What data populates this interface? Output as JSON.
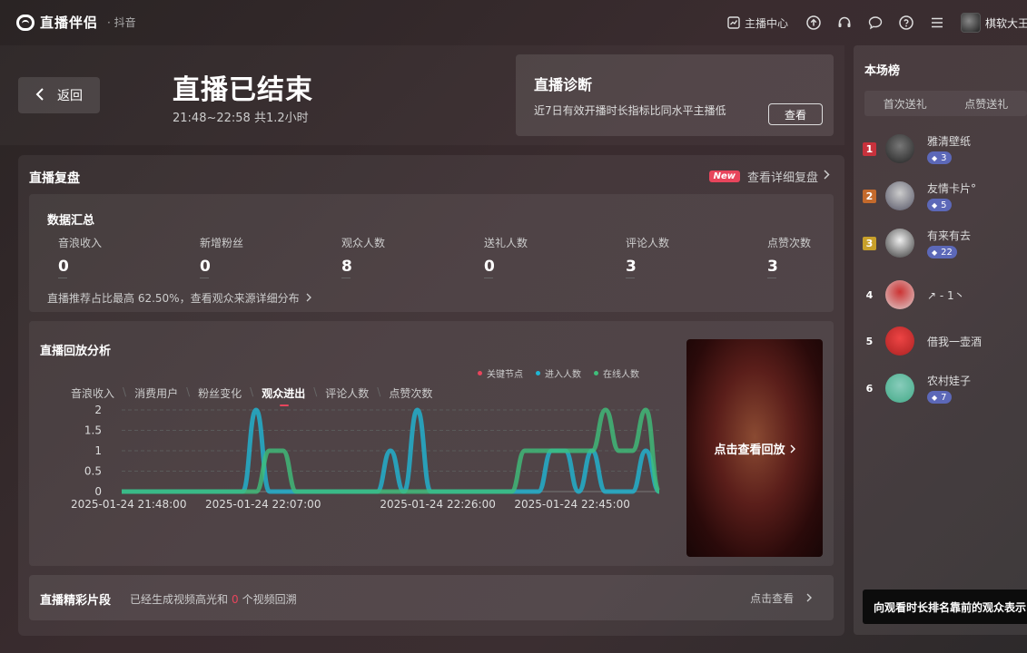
{
  "app": {
    "name": "直播伴侣",
    "platform": "· 抖音"
  },
  "topbar": {
    "creator_center": "主播中心",
    "user_name": "棋软大王"
  },
  "header": {
    "back_label": "返回",
    "title": "直播已结束",
    "time_range": "21:48~22:58 共1.2小时"
  },
  "diagnosis": {
    "title": "直播诊断",
    "description": "近7日有效开播时长指标比同水平主播低",
    "button": "查看"
  },
  "review": {
    "title": "直播复盘",
    "new_badge": "New",
    "detail_link": "查看详细复盘",
    "summary": {
      "title": "数据汇总",
      "stats": [
        {
          "label": "音浪收入",
          "value": "0"
        },
        {
          "label": "新增粉丝",
          "value": "0"
        },
        {
          "label": "观众人数",
          "value": "8"
        },
        {
          "label": "送礼人数",
          "value": "0"
        },
        {
          "label": "评论人数",
          "value": "3"
        },
        {
          "label": "点赞次数",
          "value": "3"
        }
      ],
      "note": "直播推荐占比最高 62.50%，查看观众来源详细分布"
    },
    "replay": {
      "title": "直播回放分析",
      "legend": [
        "关键节点",
        "进入人数",
        "在线人数"
      ],
      "tabs": [
        "音浪收入",
        "消费用户",
        "粉丝变化",
        "观众进出",
        "评论人数",
        "点赞次数"
      ],
      "active_tab": 3,
      "video_label": "点击查看回放"
    },
    "highlights": {
      "title": "直播精彩片段",
      "desc_prefix": "已经生成视频高光和",
      "count": "0",
      "desc_suffix": "个视频回溯",
      "link": "点击查看"
    }
  },
  "ranking": {
    "title": "本场榜",
    "tabs": [
      "首次送礼",
      "点赞送礼"
    ],
    "items": [
      {
        "rank": "1",
        "name": "雅清壁纸",
        "badge": "3"
      },
      {
        "rank": "2",
        "name": "友情卡片°",
        "badge": "5"
      },
      {
        "rank": "3",
        "name": "有来有去",
        "badge": "22"
      },
      {
        "rank": "4",
        "name": "↗ - 1丶",
        "badge": ""
      },
      {
        "rank": "5",
        "name": "借我一壶酒",
        "badge": ""
      },
      {
        "rank": "6",
        "name": "农村娃子",
        "badge": "7"
      }
    ],
    "tooltip": "向观看时长排名靠前的观众表示"
  },
  "colors": {
    "accent_red": "#e8455c",
    "series_enter": "#1fb6d4",
    "series_online": "#3fbf7a",
    "key_node": "#e8455c",
    "rank1": "#c8323c",
    "rank2": "#c46a2c",
    "rank3": "#c8a02a"
  },
  "chart_data": {
    "type": "line",
    "x": [
      "21:48",
      "21:50",
      "21:52",
      "21:54",
      "21:56",
      "21:58",
      "22:00",
      "22:02",
      "22:04",
      "22:06",
      "22:07",
      "22:08",
      "22:09",
      "22:10",
      "22:12",
      "22:14",
      "22:16",
      "22:18",
      "22:20",
      "22:22",
      "22:23",
      "22:24",
      "22:25",
      "22:26",
      "22:28",
      "22:30",
      "22:32",
      "22:34",
      "22:36",
      "22:38",
      "22:40",
      "22:42",
      "22:44",
      "22:45",
      "22:46",
      "22:48",
      "22:50",
      "22:52",
      "22:54",
      "22:56",
      "22:58"
    ],
    "x_ticks": [
      "2025-01-24 21:48:00",
      "2025-01-24 22:07:00",
      "2025-01-24 22:26:00",
      "2025-01-24 22:45:00"
    ],
    "series": [
      {
        "name": "进入人数",
        "values": [
          0,
          0,
          0,
          0,
          0,
          0,
          0,
          0,
          0,
          0,
          2,
          0,
          0,
          0,
          0,
          0,
          0,
          0,
          0,
          0,
          1,
          0,
          2,
          0,
          0,
          0,
          0,
          0,
          0,
          0,
          0,
          0,
          1,
          1,
          0,
          1,
          0,
          0,
          0,
          1,
          0
        ]
      },
      {
        "name": "在线人数",
        "values": [
          0,
          0,
          0,
          0,
          0,
          0,
          0,
          0,
          0,
          0,
          0,
          1,
          1,
          0,
          0,
          0,
          0,
          0,
          0,
          0,
          0,
          0,
          0,
          0,
          0,
          0,
          0,
          0,
          0,
          0,
          1,
          1,
          1,
          1,
          1,
          1,
          2,
          1,
          1,
          2,
          0
        ]
      }
    ],
    "ylim": [
      0,
      2
    ],
    "y_ticks": [
      "0",
      "0.5",
      "1",
      "1.5",
      "2"
    ]
  }
}
